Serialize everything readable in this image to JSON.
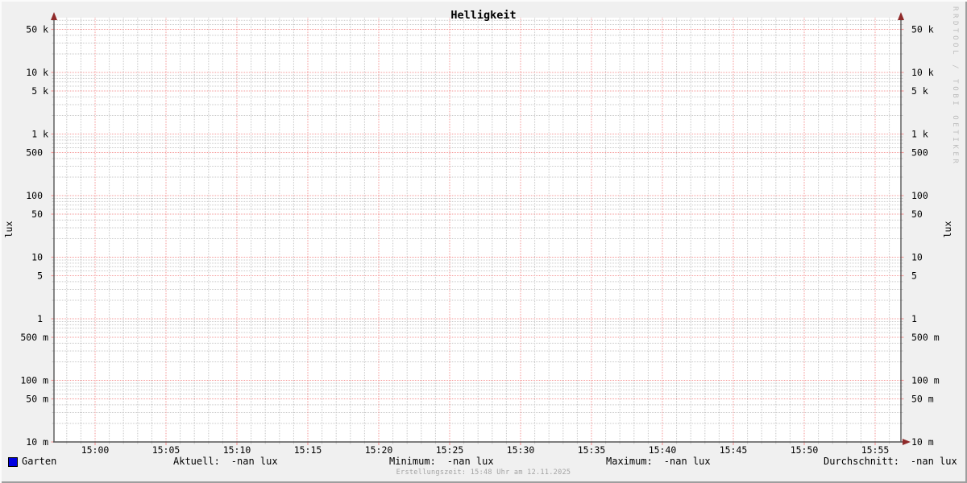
{
  "watermark": "RRDTOOL / TOBI OETIKER",
  "footer": {
    "created": "Erstellungszeit: 15:48 Uhr am 12.11.2025"
  },
  "legend": {
    "series_label": "Garten",
    "swatch_color": "#0000e0",
    "stats": [
      {
        "label": "Aktuell:",
        "value": "-nan lux"
      },
      {
        "label": "Minimum:",
        "value": "-nan lux"
      },
      {
        "label": "Maximum:",
        "value": "-nan lux"
      },
      {
        "label": "Durchschnitt:",
        "value": "-nan lux"
      }
    ]
  },
  "colors": {
    "background": "#f0f0f0",
    "plot_bg": "#ffffff",
    "grid_minor": "#c9c9c9",
    "grid_major": "#f59898",
    "axis": "#555555",
    "arrow": "#8f2a2a",
    "series_blue": "#0000e0",
    "text": "#000000",
    "muted": "#a3a3a3",
    "watermark": "#bdbdbd"
  },
  "chart_data": {
    "type": "line",
    "title": "Helligkeit",
    "xlabel": "",
    "ylabel": "lux",
    "y_scale": "log",
    "ylim": [
      0.01,
      77000
    ],
    "xlim": [
      "14:57",
      "15:57"
    ],
    "grid": "on",
    "legend_position": "bottom",
    "x_ticks": [
      {
        "t": 0,
        "label": "15:00"
      },
      {
        "t": 5,
        "label": "15:05"
      },
      {
        "t": 10,
        "label": "15:10"
      },
      {
        "t": 15,
        "label": "15:15"
      },
      {
        "t": 20,
        "label": "15:20"
      },
      {
        "t": 25,
        "label": "15:25"
      },
      {
        "t": 30,
        "label": "15:30"
      },
      {
        "t": 35,
        "label": "15:35"
      },
      {
        "t": 40,
        "label": "15:40"
      },
      {
        "t": 45,
        "label": "15:45"
      },
      {
        "t": 50,
        "label": "15:50"
      },
      {
        "t": 55,
        "label": "15:55"
      }
    ],
    "y_ticks": [
      {
        "v": 50000,
        "n": "50",
        "s": "k"
      },
      {
        "v": 10000,
        "n": "10",
        "s": "k"
      },
      {
        "v": 5000,
        "n": "5",
        "s": "k"
      },
      {
        "v": 1000,
        "n": "1",
        "s": "k"
      },
      {
        "v": 500,
        "n": "500",
        "s": ""
      },
      {
        "v": 100,
        "n": "100",
        "s": ""
      },
      {
        "v": 50,
        "n": "50",
        "s": ""
      },
      {
        "v": 10,
        "n": "10",
        "s": ""
      },
      {
        "v": 5,
        "n": "5",
        "s": ""
      },
      {
        "v": 1,
        "n": "1",
        "s": ""
      },
      {
        "v": 0.5,
        "n": "500",
        "s": "m"
      },
      {
        "v": 0.1,
        "n": "100",
        "s": "m"
      },
      {
        "v": 0.05,
        "n": "50",
        "s": "m"
      },
      {
        "v": 0.01,
        "n": "10",
        "s": "m"
      }
    ],
    "series": [
      {
        "name": "Garten",
        "color": "#0000e0",
        "values": [],
        "data_status": "no data plotted (all values -nan)",
        "stats": {
          "aktuell": "-nan",
          "minimum": "-nan",
          "maximum": "-nan",
          "durchschnitt": "-nan",
          "unit": "lux"
        }
      }
    ]
  }
}
